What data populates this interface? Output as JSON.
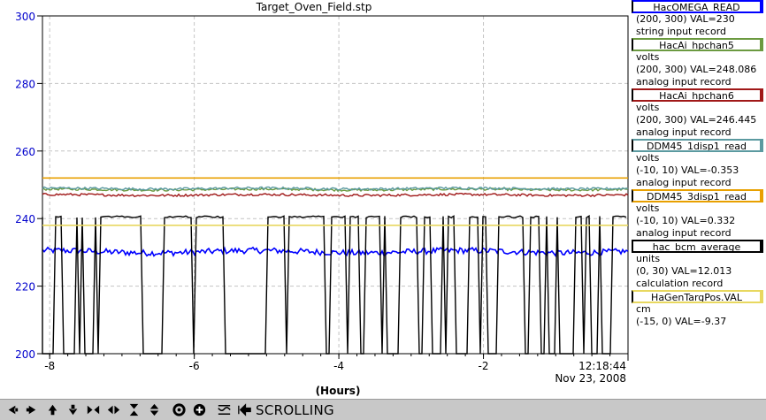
{
  "chart_data": {
    "type": "line",
    "title": "Target_Oven_Field.stp",
    "xlabel": "(Hours)",
    "ylabel": "",
    "xlim": [
      -8.1,
      0
    ],
    "ylim": [
      200,
      300
    ],
    "x_ticks": [
      -8,
      -6,
      -4,
      -2
    ],
    "x_tick_labels": [
      "-8",
      "-6",
      "-4",
      "-2"
    ],
    "y_ticks": [
      200,
      220,
      240,
      260,
      280,
      300
    ],
    "y_tick_labels": [
      "200",
      "220",
      "240",
      "260",
      "280",
      "300"
    ],
    "time_label": "12:18:44",
    "date_label": "Nov 23, 2008",
    "grid": true,
    "series": [
      {
        "name": "HacOMEGA_READ",
        "color": "#0000ff",
        "style": "noisy",
        "level": 230.2
      },
      {
        "name": "HacAi_hpchan5",
        "color": "#6b9a40",
        "style": "steady",
        "level": 248.6
      },
      {
        "name": "HacAi_hpchan6",
        "color": "#a01818",
        "style": "steady",
        "level": 247.0
      },
      {
        "name": "DDM45_1disp1_read",
        "color": "#5b9aa0",
        "style": "steady",
        "level": 248.9
      },
      {
        "name": "DDM45_3disp1_read",
        "color": "#e8a000",
        "style": "flat",
        "level": 252.0
      },
      {
        "name": "hac_bcm_average",
        "color": "#000000",
        "style": "square",
        "level_high": 240.5,
        "level_low": 200
      },
      {
        "name": "HaGenTargPos.VAL",
        "color": "#e8d860",
        "style": "flat",
        "level": 238.0
      }
    ]
  },
  "legend": [
    {
      "name": "HacOMEGA_READ",
      "color": "#0000ff",
      "lines": [
        "(200, 300) VAL=230",
        "string input record"
      ]
    },
    {
      "name": "HacAi_hpchan5",
      "color": "#6b9a40",
      "lines": [
        "volts",
        "(200, 300) VAL=248.086",
        "analog input record"
      ]
    },
    {
      "name": "HacAi_hpchan6",
      "color": "#a01818",
      "lines": [
        "volts",
        "(200, 300) VAL=246.445",
        "analog input record"
      ]
    },
    {
      "name": "DDM45_1disp1_read",
      "color": "#5b9aa0",
      "lines": [
        "volts",
        "(-10, 10) VAL=-0.353",
        "analog input record"
      ]
    },
    {
      "name": "DDM45_3disp1_read",
      "color": "#e8a000",
      "lines": [
        "volts",
        "(-10, 10) VAL=0.332",
        "analog input record"
      ]
    },
    {
      "name": "hac_bcm_average",
      "color": "#000000",
      "lines": [
        "units",
        "(0, 30) VAL=12.013",
        "calculation record"
      ]
    },
    {
      "name": "HaGenTargPos.VAL",
      "color": "#e8d860",
      "lines": [
        "cm",
        "(-15, 0) VAL=-9.37"
      ]
    }
  ],
  "toolbar": {
    "buttons": [
      {
        "name": "scroll-left-button",
        "icon": "arrow-left-icon"
      },
      {
        "name": "scroll-right-button",
        "icon": "arrow-right-icon"
      },
      {
        "name": "scroll-up-button",
        "icon": "arrow-up-icon"
      },
      {
        "name": "scroll-down-button",
        "icon": "arrow-down-icon"
      },
      {
        "name": "zoom-in-x-button",
        "icon": "zoom-in-x-icon"
      },
      {
        "name": "zoom-out-x-button",
        "icon": "zoom-out-x-icon"
      },
      {
        "name": "zoom-in-y-button",
        "icon": "zoom-in-y-icon"
      },
      {
        "name": "zoom-out-y-button",
        "icon": "zoom-out-y-icon"
      },
      {
        "name": "auto-zoom-button",
        "icon": "target-icon"
      },
      {
        "name": "default-zoom-button",
        "icon": "plus-icon"
      },
      {
        "name": "stagger-axes-button",
        "icon": "stagger-icon"
      },
      {
        "name": "scroll-mode-button",
        "icon": "scroll-mode-icon"
      }
    ],
    "mode_label": "SCROLLING"
  }
}
